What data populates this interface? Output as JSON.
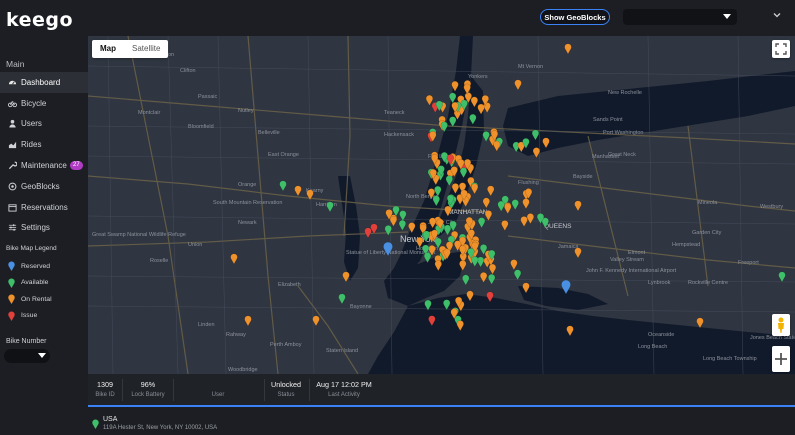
{
  "app": {
    "logo": "keego"
  },
  "topbar": {
    "show_geoblocks": "Show GeoBlocks",
    "select_value": ""
  },
  "sidebar": {
    "section": "Main",
    "items": [
      {
        "label": "Dashboard",
        "icon": "dashboard-icon",
        "active": true
      },
      {
        "label": "Bicycle",
        "icon": "bicycle-icon"
      },
      {
        "label": "Users",
        "icon": "user-icon"
      },
      {
        "label": "Rides",
        "icon": "chart-icon"
      },
      {
        "label": "Maintenance",
        "icon": "wrench-icon",
        "badge": "27"
      },
      {
        "label": "GeoBlocks",
        "icon": "geoblock-icon"
      },
      {
        "label": "Reservations",
        "icon": "calendar-icon"
      },
      {
        "label": "Settings",
        "icon": "sliders-icon"
      }
    ],
    "legend_title": "Bike Map Legend",
    "legend": [
      {
        "label": "Reserved",
        "color": "#4a90e2"
      },
      {
        "label": "Available",
        "color": "#3fbf6a"
      },
      {
        "label": "On Rental",
        "color": "#f0922b"
      },
      {
        "label": "Issue",
        "color": "#e2413b"
      }
    ],
    "bike_number_label": "Bike Number",
    "bike_number_value": ""
  },
  "map": {
    "tabs": [
      "Map",
      "Satellite"
    ],
    "active_tab": "Map",
    "labels": [
      "Yonkers",
      "Mt Vernon",
      "New Rochelle",
      "Great Neck",
      "Paterson",
      "Clifton",
      "Passaic",
      "Montclair",
      "Bloomfield",
      "Nutley",
      "Belleville",
      "East Orange",
      "Orange",
      "Newark",
      "Elizabeth",
      "Hackensack",
      "Teaneck",
      "Fort Lee",
      "North Bergen",
      "Jersey City",
      "Hoboken",
      "MANHATTAN",
      "New York",
      "QUEENS",
      "Flushing",
      "Jamaica",
      "Hempstead",
      "Statue of Liberty National Monument",
      "Staten Island",
      "Bayonne",
      "Linden",
      "Rahway",
      "Woodbridge",
      "Perth Amboy",
      "John F. Kennedy International Airport",
      "Long Beach",
      "Valley Stream",
      "Elmont",
      "Rockville Centre",
      "Freeport",
      "Lynbrook",
      "Garden City",
      "Mineola",
      "Westbury",
      "Oceanside",
      "South Mountain Reservation",
      "Great Swamp National Wildlife Refuge",
      "Union",
      "Roselle",
      "Kearny",
      "Harrison",
      "Bayside",
      "Sands Point",
      "Port Washington",
      "Manhasset",
      "Jones Beach State Park",
      "Long Beach Township"
    ],
    "colors": {
      "water": "#111a2b",
      "land": "#2f3541",
      "road": "#6b6248"
    }
  },
  "info": {
    "bike_id": {
      "value": "1309",
      "label": "Bike ID"
    },
    "battery": {
      "value": "96%",
      "label": "Lock Battery"
    },
    "user": {
      "value": "",
      "label": "User"
    },
    "status": {
      "value": "Unlocked",
      "label": "Status"
    },
    "activity": {
      "value": "Aug 17 12:02 PM",
      "label": "Last Activity"
    }
  },
  "address": {
    "country": "USA",
    "line": "119A Hester St, New York, NY 10002, USA"
  }
}
